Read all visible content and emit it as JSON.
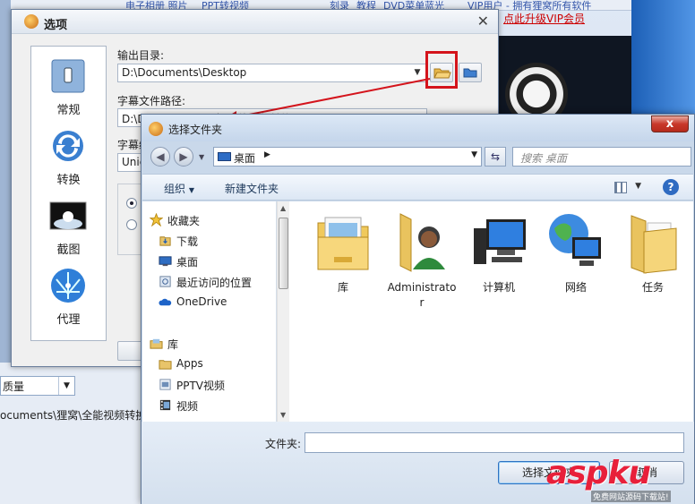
{
  "background": {
    "top_links": [
      "电子相册 照片",
      "PPT转视频",
      "刻录",
      "教程",
      "DVD菜单",
      "蓝光",
      "VIP用户 - 拥有狸窝所有软件"
    ],
    "vip_link": "点此升级VIP会员",
    "quality_value": "质量",
    "output_path_partial": "ocuments\\狸窝\\全能视频转换器"
  },
  "options_dialog": {
    "title": "选项",
    "close_glyph": "✕",
    "sidebar": [
      {
        "label": "常规",
        "icon": "general-icon"
      },
      {
        "label": "转换",
        "icon": "convert-icon"
      },
      {
        "label": "截图",
        "icon": "screenshot-icon"
      },
      {
        "label": "代理",
        "icon": "proxy-icon"
      }
    ],
    "output_dir_label": "输出目录:",
    "output_dir_value": "D:\\Documents\\Desktop",
    "subtitle_path_label": "字幕文件路径:",
    "subtitle_path_value": "D:\\Documents\\狸窝\\全能视频转换器",
    "subtitle_encoding_label": "字幕编",
    "subtitle_encoding_value": "Unic"
  },
  "select_folder_dialog": {
    "title": "选择文件夹",
    "close_glyph": "x",
    "address_value": "桌面",
    "search_placeholder": "搜索 桌面",
    "toolbar": {
      "organize": "组织",
      "new_folder": "新建文件夹",
      "help_glyph": "?"
    },
    "nav_items": [
      {
        "label": "收藏夹",
        "icon": "favorites-star-icon",
        "indent": 0
      },
      {
        "label": "下载",
        "icon": "downloads-icon",
        "indent": 1
      },
      {
        "label": "桌面",
        "icon": "desktop-icon",
        "indent": 1
      },
      {
        "label": "最近访问的位置",
        "icon": "recent-places-icon",
        "indent": 1
      },
      {
        "label": "OneDrive",
        "icon": "onedrive-cloud-icon",
        "indent": 1
      },
      {
        "label": "",
        "icon": "",
        "indent": 0
      },
      {
        "label": "库",
        "icon": "libraries-icon",
        "indent": 0
      },
      {
        "label": "Apps",
        "icon": "apps-folder-icon",
        "indent": 1
      },
      {
        "label": "PPTV视频",
        "icon": "pptv-video-icon",
        "indent": 1
      },
      {
        "label": "视频",
        "icon": "videos-icon",
        "indent": 1
      }
    ],
    "files": [
      {
        "label": "库",
        "icon": "libraries-folder-icon"
      },
      {
        "label": "Administrator",
        "icon": "user-folder-icon"
      },
      {
        "label": "计算机",
        "icon": "computer-icon"
      },
      {
        "label": "网络",
        "icon": "network-globe-icon"
      },
      {
        "label": "任务",
        "icon": "folder-icon"
      }
    ],
    "folder_label": "文件夹:",
    "folder_value": "",
    "ok_button": "选择文件夹",
    "cancel_button": "取消"
  },
  "watermark": {
    "brand": "aspku",
    "tagline": "免费网站源码下载站!"
  },
  "colors": {
    "highlight_red": "#d4141c",
    "accent_blue": "#2f6bc1"
  }
}
